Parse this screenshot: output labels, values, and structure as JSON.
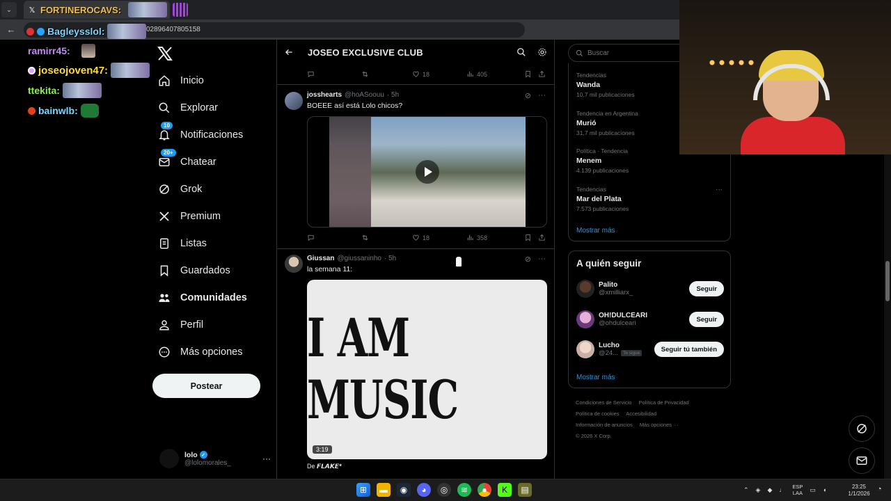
{
  "browser": {
    "tab_title": "FORTINEROCAVS:",
    "url_text": "02896407805158"
  },
  "overlay_chat": [
    {
      "user": "ramirr45:",
      "color": "#c08af5"
    },
    {
      "user": "joseojoven47:",
      "color": "#ffdd33"
    },
    {
      "user": "ttekita:",
      "color": "#8ef04e"
    },
    {
      "user": "bainwlb:",
      "color": "#7ad7ff"
    },
    {
      "user": "Bagleysslol:",
      "color": "#7ad7ff"
    }
  ],
  "nav": {
    "items": [
      {
        "label": "Inicio",
        "icon": "home-icon"
      },
      {
        "label": "Explorar",
        "icon": "search-icon"
      },
      {
        "label": "Notificaciones",
        "icon": "bell-icon",
        "badge": "10"
      },
      {
        "label": "Chatear",
        "icon": "mail-icon",
        "badge": "20+"
      },
      {
        "label": "Grok",
        "icon": "grok-icon"
      },
      {
        "label": "Premium",
        "icon": "x-icon"
      },
      {
        "label": "Listas",
        "icon": "list-icon"
      },
      {
        "label": "Guardados",
        "icon": "bookmark-icon"
      },
      {
        "label": "Comunidades",
        "icon": "people-icon"
      },
      {
        "label": "Perfil",
        "icon": "person-icon"
      },
      {
        "label": "Más opciones",
        "icon": "more-circle-icon"
      }
    ],
    "post_label": "Postear",
    "account": {
      "name": "lolo",
      "handle": "@lolomorales_"
    }
  },
  "main": {
    "title": "JOSEO EXCLUSIVE CLUB",
    "top_actions": {
      "likes": "18",
      "views": "405"
    },
    "tweets": [
      {
        "name": "josshearts",
        "handle": "@hoASoouu",
        "time": "· 5h",
        "text": "BOEEE así está Lolo chicos?",
        "likes": "18",
        "views": "358"
      },
      {
        "name": "Giussan",
        "handle": "@giussaninho",
        "time": "· 5h",
        "text": "la semana 11:",
        "media_text": "I AM MUSIC",
        "duration": "3:19",
        "from_prefix": "De",
        "from_name": "𝙁𝙇𝘼𝙆𝙀*"
      }
    ]
  },
  "sidebar": {
    "search_placeholder": "Buscar",
    "trends": [
      {
        "context": "Tendencias",
        "title": "Wanda",
        "count": "10,7 mil publicaciones"
      },
      {
        "context": "Tendencia en Argentina",
        "title": "Murió",
        "count": "31,7 mil publicaciones"
      },
      {
        "context": "Política · Tendencia",
        "title": "Menem",
        "count": "4.139 publicaciones"
      },
      {
        "context": "Tendencias",
        "title": "Mar del Plata",
        "count": "7.573 publicaciones"
      }
    ],
    "show_more": "Mostrar más",
    "who_to_follow": {
      "title": "A quién seguir",
      "users": [
        {
          "name": "Palito",
          "handle": "@xmilliarx_",
          "button": "Seguir"
        },
        {
          "name": "OH!DULCEARI",
          "handle": "@ohdulceari",
          "button": "Seguir"
        },
        {
          "name": "Lucho",
          "handle": "@24...",
          "tag": "Te sigue",
          "button": "Seguir tú también"
        }
      ],
      "show_more": "Mostrar más"
    },
    "footer": [
      "Condiciones de Servicio",
      "Política de Privacidad",
      "Política de cookies",
      "Accesibilidad",
      "Información de anuncios",
      "Más opciones ···",
      "© 2026 X Corp."
    ]
  },
  "taskbar": {
    "lang_top": "ESP",
    "lang_bottom": "LAA",
    "time": "23:25",
    "date": "1/1/2026"
  },
  "colors": {
    "accent": "#1d9bf0",
    "background": "#000000",
    "border": "#2f3336"
  }
}
